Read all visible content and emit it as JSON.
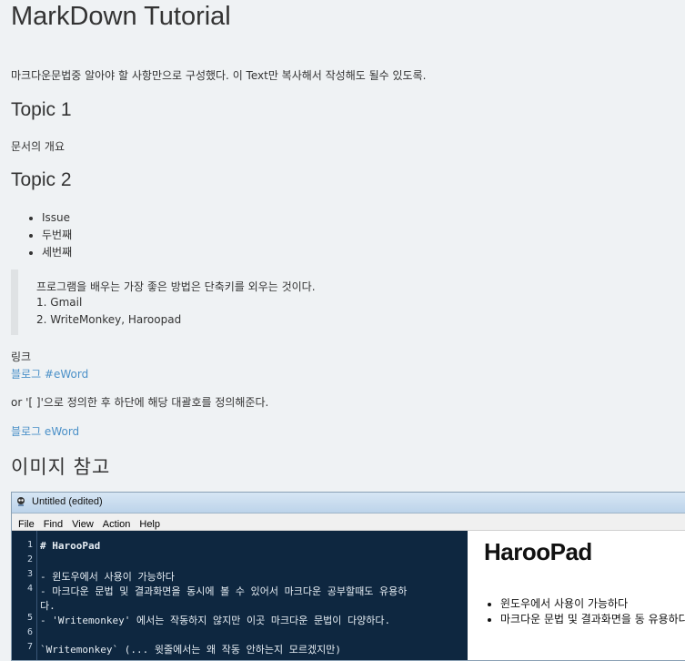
{
  "doc": {
    "title": "MarkDown Tutorial",
    "intro": "마크다운문법중 알아야 할 사항만으로 구성했다. 이 Text만 복사해서 작성해도 될수 있도록.",
    "topic1": "Topic 1",
    "topic1_text": "문서의 개요",
    "topic2": "Topic 2",
    "bullets": [
      "Issue",
      "두번째",
      "세번째"
    ],
    "quote": {
      "line": "프로그램을 배우는 가장 좋은 방법은 단축키를 외우는 것이다.",
      "items": [
        "1. Gmail",
        "2. WriteMonkey, Haroopad"
      ]
    },
    "link_label": "링크",
    "link1": "블로그 #eWord",
    "note": "or '[ ]'으로 정의한 후 하단에 해당 대괄호를 정의해준다.",
    "link2": "블로그 eWord",
    "image_heading": "이미지 참고"
  },
  "screenshot": {
    "window_title": "Untitled (edited)",
    "menu": [
      "File",
      "Find",
      "View",
      "Action",
      "Help"
    ],
    "editor_lines": [
      {
        "n": "1",
        "text": "# HarooPad"
      },
      {
        "n": "2",
        "text": ""
      },
      {
        "n": "3",
        "text": "- 윈도우에서 사용이 가능하다"
      },
      {
        "n": "4",
        "text": "- 마크다운 문법 및 결과화면을 동시에 볼 수 있어서 마크다운 공부할때도 유용하"
      },
      {
        "n": "",
        "text": "다."
      },
      {
        "n": "5",
        "text": "- 'Writemonkey' 에서는 작동하지 않지만 이곳 마크다운 문법이 다양하다."
      },
      {
        "n": "6",
        "text": ""
      },
      {
        "n": "7",
        "text": "    `Writemonkey` (... 윗줄에서는 왜 작동 안하는지 모르겠지만)"
      }
    ],
    "preview_title": "HarooPad",
    "preview_items": [
      "윈도우에서 사용이 가능하다",
      "마크다운 문법 및 결과화면을 동 유용하다."
    ]
  },
  "colors": {
    "background": "#eff2f4",
    "link": "#4a90c8",
    "editor_bg": "#0e2740"
  }
}
